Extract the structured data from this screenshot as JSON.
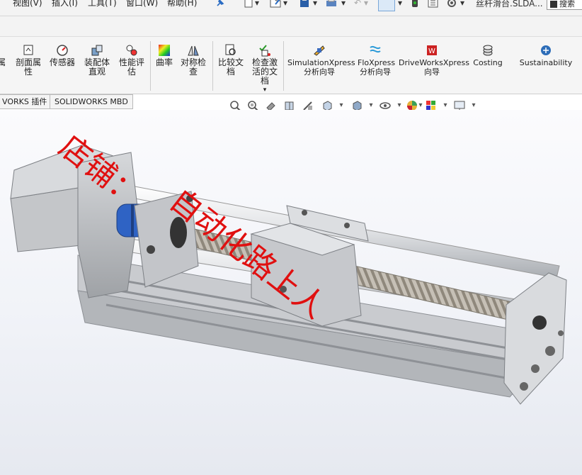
{
  "menubar": {
    "items": [
      "视图(V)",
      "插入(I)",
      "工具(T)",
      "窗口(W)",
      "帮助(H)"
    ],
    "document_name": "丝杆滑台.SLDA...",
    "search_label": "搜索"
  },
  "ribbon": {
    "buttons": [
      {
        "label": "属",
        "icon": "property-icon"
      },
      {
        "label": "剖面属性",
        "icon": "section-properties-icon"
      },
      {
        "label": "传感器",
        "icon": "sensor-icon"
      },
      {
        "label": "装配体直观",
        "icon": "assembly-visualization-icon"
      },
      {
        "label": "性能评估",
        "icon": "performance-evaluation-icon"
      },
      {
        "label": "曲率",
        "icon": "curvature-icon"
      },
      {
        "label": "对称检查",
        "icon": "symmetry-check-icon"
      },
      {
        "label": "比较文档",
        "icon": "compare-documents-icon"
      },
      {
        "label": "检查激活的文档",
        "icon": "check-active-document-icon"
      },
      {
        "label": "SimulationXpress分析向导",
        "icon": "simulationxpress-icon"
      },
      {
        "label": "FloXpress分析向导",
        "icon": "floxpress-icon"
      },
      {
        "label": "DriveWorksXpress向导",
        "icon": "driveworksxpress-icon"
      },
      {
        "label": "Costing",
        "icon": "costing-icon"
      },
      {
        "label": "Sustainability",
        "icon": "sustainability-icon"
      }
    ]
  },
  "tabs": [
    "VORKS 插件",
    "SOLIDWORKS MBD"
  ],
  "watermark": {
    "line1": "店铺：",
    "line2": "自动化路上人",
    "color": "#e01010"
  },
  "model": {
    "frame_color": "#c4c6c9",
    "coupling_color": "#2f63c4",
    "screw_color": "#bdb7ad"
  }
}
